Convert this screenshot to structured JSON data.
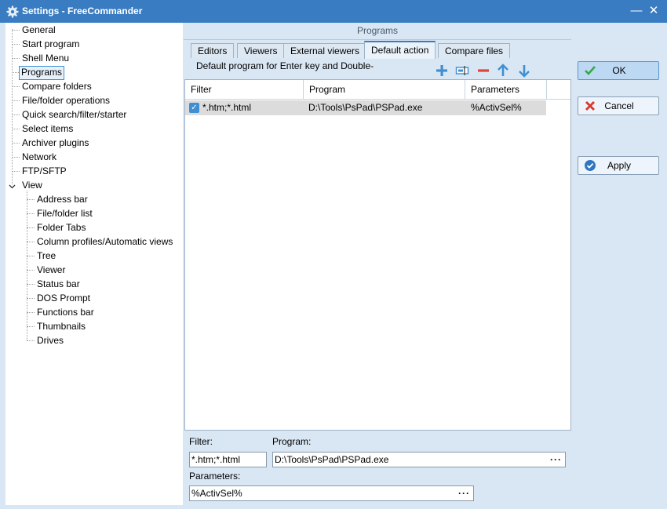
{
  "window": {
    "title": "Settings - FreeCommander",
    "minimize_glyph": "—",
    "close_glyph": "✕"
  },
  "tree": {
    "items": [
      {
        "label": "General"
      },
      {
        "label": "Start program"
      },
      {
        "label": "Shell Menu"
      },
      {
        "label": "Programs",
        "selected": true
      },
      {
        "label": "Compare folders"
      },
      {
        "label": "File/folder operations"
      },
      {
        "label": "Quick search/filter/starter"
      },
      {
        "label": "Select items"
      },
      {
        "label": "Archiver plugins"
      },
      {
        "label": "Network"
      },
      {
        "label": "FTP/SFTP"
      },
      {
        "label": "View",
        "expanded": true
      }
    ],
    "view_children": [
      {
        "label": "Address bar"
      },
      {
        "label": "File/folder list"
      },
      {
        "label": "Folder Tabs"
      },
      {
        "label": "Column profiles/Automatic views"
      },
      {
        "label": "Tree"
      },
      {
        "label": "Viewer"
      },
      {
        "label": "Status bar"
      },
      {
        "label": "DOS Prompt"
      },
      {
        "label": "Functions bar"
      },
      {
        "label": "Thumbnails"
      },
      {
        "label": "Drives"
      }
    ]
  },
  "main": {
    "header": "Programs",
    "tabs": [
      {
        "label": "Editors"
      },
      {
        "label": "Viewers"
      },
      {
        "label": "External viewers"
      },
      {
        "label": "Default action",
        "active": true
      },
      {
        "label": "Compare files"
      }
    ],
    "description": "Default program for Enter key and Double-",
    "toolbar": {
      "icons": [
        "add-icon",
        "edit-icon",
        "remove-icon",
        "move-up-icon",
        "move-down-icon"
      ]
    },
    "grid": {
      "columns": [
        "Filter",
        "Program",
        "Parameters"
      ],
      "rows": [
        {
          "checked": true,
          "filter": "*.htm;*.html",
          "program": "D:\\Tools\\PsPad\\PSPad.exe",
          "parameters": "%ActivSel%"
        }
      ]
    },
    "form": {
      "filter_label": "Filter:",
      "filter_value": "*.htm;*.html",
      "program_label": "Program:",
      "program_value": "D:\\Tools\\PsPad\\PSPad.exe",
      "parameters_label": "Parameters:",
      "parameters_value": "%ActivSel%",
      "browse_glyph": "···"
    }
  },
  "buttons": {
    "ok": "OK",
    "cancel": "Cancel",
    "apply": "Apply"
  },
  "colors": {
    "titlebar": "#3a7cc1",
    "accent": "#3f8fd2",
    "remove": "#e0433a",
    "panel": "#d9e6f3"
  }
}
